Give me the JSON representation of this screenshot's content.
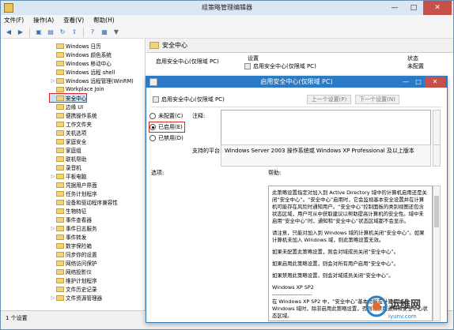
{
  "window": {
    "title": "组策略管理编辑器",
    "minimize": "—",
    "maximize": "□",
    "close": "✕"
  },
  "menu": [
    "文件(F)",
    "操作(A)",
    "查看(V)",
    "帮助(H)"
  ],
  "toolbar": [
    "back-icon",
    "forward-icon",
    "up-folder-icon",
    "show-hide-icon",
    "refresh-icon",
    "export-icon",
    "help-icon",
    "properties-icon",
    "filter-icon"
  ],
  "tree": [
    {
      "label": "Windows 日历"
    },
    {
      "label": "Windows 颜色系统"
    },
    {
      "label": "Windows 移动中心"
    },
    {
      "label": "Windows 远程 shell"
    },
    {
      "label": "Windows 远程管理(WinRM)",
      "expand": true
    },
    {
      "label": "Workplace Join"
    },
    {
      "label": "安全中心",
      "highlight": true
    },
    {
      "label": "边缘 UI"
    },
    {
      "label": "便携操作系统"
    },
    {
      "label": "工作文件夹"
    },
    {
      "label": "关机选项"
    },
    {
      "label": "家庭安全"
    },
    {
      "label": "家庭组"
    },
    {
      "label": "联机帮助"
    },
    {
      "label": "录音机"
    },
    {
      "label": "平板电脑",
      "expand": true
    },
    {
      "label": "凭据用户界面"
    },
    {
      "label": "任务计划程序"
    },
    {
      "label": "设备和驱动程序兼容性"
    },
    {
      "label": "生物特征"
    },
    {
      "label": "事件查看器"
    },
    {
      "label": "事件日志服务",
      "expand": true
    },
    {
      "label": "事件转发"
    },
    {
      "label": "数字保险箱"
    },
    {
      "label": "同步你的设置"
    },
    {
      "label": "网络访问保护"
    },
    {
      "label": "网络投影仪"
    },
    {
      "label": "维护计划程序"
    },
    {
      "label": "文件历史记录"
    },
    {
      "label": "文件资源管理器",
      "expand": true
    }
  ],
  "right_pane": {
    "header": "安全中心",
    "description": "启用安全中心(仅限域 PC)",
    "col_setting": "设置",
    "col_state": "状态",
    "row_label": "启用安全中心(仅限域 PC)",
    "row_state": "未配置"
  },
  "dialog": {
    "title": "启用安全中心(仅限域 PC)",
    "setting_name": "启用安全中心(仅限域 PC)",
    "prev_button": "上一个设置(P)",
    "next_button": "下一个设置(N)",
    "radio_not_configured": "未配置(C)",
    "radio_enabled": "已启用(E)",
    "radio_disabled": "已禁用(D)",
    "comment_label": "注释:",
    "platform_label": "支持的平台:",
    "platform_value": "Windows Server 2003 操作系统或 Windows XP Professional 及以上版本",
    "options_label": "选项:",
    "help_label": "帮助:",
    "help_paragraphs": [
      "此策略设置指定对加入到 Active Directory 域中的计算机启用还是关闭“安全中心”。“安全中心”启用时，它会监视基本安全设置并在计算机可能存在风险时通知用户。“安全中心”控制面板的类别视图还包含状态区域，用户可从中获取建议以帮助提高计算机的安全性。域中未启用“安全中心”时，通知和“安全中心”状态区域都不会显示。",
      "请注意，只能对加入到 Windows 域的计算机关闭“安全中心”。如果计算机未加入 Windows 域，则此策略设置无效。",
      "如果未配置此策略设置，则会对域成员关闭“安全中心”。",
      "如果启用此策略设置，则会对所有用户启用“安全中心”。",
      "如果禁用此策略设置，则会对域成员关闭“安全中心”。",
      "Windows XP SP2\n----------------------\n在 Windows XP SP2 中，“安全中心”基本功能在计算机加入 Windows 域时，除非启用此策略设置，否则将禁用通知和安全中心状态区域。"
    ]
  },
  "status": "1 个设置",
  "watermark": {
    "text": "运维网",
    "sub": "iyunv.com"
  }
}
